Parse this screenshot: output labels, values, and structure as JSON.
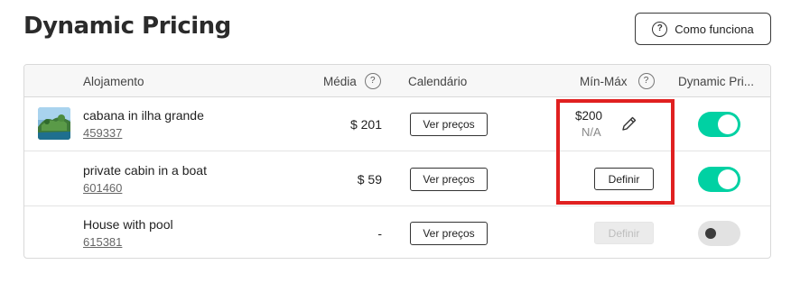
{
  "header": {
    "title": "Dynamic Pricing",
    "help_button_label": "Como funciona",
    "help_icon_glyph": "?"
  },
  "table": {
    "columns": {
      "listing": "Alojamento",
      "average": "Média",
      "calendar": "Calendário",
      "min_max": "Mín-Máx",
      "dynamic": "Dynamic Pri..."
    },
    "info_icon_glyph": "?",
    "rows": [
      {
        "name": "cabana in ilha grande",
        "id": "459337",
        "average": "$ 201",
        "calendar_button": "Ver preços",
        "min": "$200",
        "max": "N/A",
        "dynamic_enabled": true,
        "thumbnail": "tropical-island-photo"
      },
      {
        "name": "private cabin in a boat",
        "id": "601460",
        "average": "$ 59",
        "calendar_button": "Ver preços",
        "define_button": "Definir",
        "dynamic_enabled": true,
        "thumbnail": "blank"
      },
      {
        "name": "House with pool",
        "id": "615381",
        "average": "-",
        "calendar_button": "Ver preços",
        "define_button": "Definir",
        "define_disabled": true,
        "dynamic_enabled": false,
        "thumbnail": "blank"
      }
    ]
  },
  "colors": {
    "toggle_on": "#00d1a3",
    "toggle_off": "#e2e2e2",
    "highlight": "#e02020"
  },
  "icons": {
    "help": "question-circle-icon",
    "edit": "pencil-icon"
  }
}
